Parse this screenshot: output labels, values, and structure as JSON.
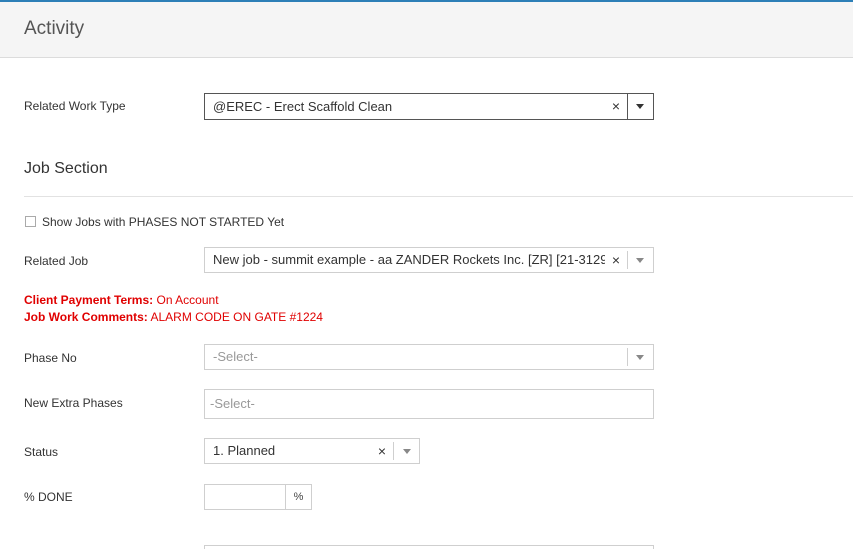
{
  "header": {
    "title": "Activity"
  },
  "related_work_type": {
    "label": "Related Work Type",
    "value": "@EREC - Erect Scaffold Clean",
    "clear_glyph": "×"
  },
  "job_section": {
    "title": "Job Section"
  },
  "show_jobs": {
    "label": "Show Jobs with PHASES NOT STARTED Yet"
  },
  "related_job": {
    "label": "Related Job",
    "value": "New job - summit example - aa ZANDER Rockets Inc. [ZR] [21-3129...",
    "clear_glyph": "×"
  },
  "client_payment_terms": {
    "label": "Client Payment Terms:",
    "value": "On Account"
  },
  "job_work_comments": {
    "label": "Job Work Comments:",
    "value": "ALARM CODE ON GATE #1224"
  },
  "phase_no": {
    "label": "Phase No",
    "placeholder": "-Select-"
  },
  "new_extra_phases": {
    "label": "New Extra Phases",
    "placeholder": "-Select-"
  },
  "status": {
    "label": "Status",
    "value": "1. Planned",
    "clear_glyph": "×"
  },
  "percent_done": {
    "label": "% DONE",
    "value": "",
    "addon": "%"
  },
  "colors": {
    "accent": "#2d7fb7",
    "alert": "#e00000"
  }
}
